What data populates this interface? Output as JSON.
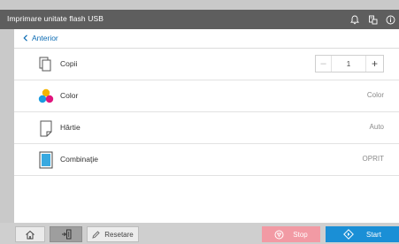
{
  "header": {
    "title": "Imprimare unitate flash USB",
    "icons": [
      "bell-icon",
      "usb-connection-icon",
      "info-icon"
    ]
  },
  "nav": {
    "back_label": "Anterior"
  },
  "settings": [
    {
      "id": "copies",
      "label": "Copii",
      "icon": "copies-icon",
      "value": "1"
    },
    {
      "id": "color",
      "label": "Color",
      "icon": "color-dots-icon",
      "value": "Color"
    },
    {
      "id": "paper",
      "label": "Hârtie",
      "icon": "paper-icon",
      "value": "Auto"
    },
    {
      "id": "combination",
      "label": "Combinaţie",
      "icon": "combination-icon",
      "value": "OPRIT"
    }
  ],
  "stepper": {
    "minus": "–",
    "plus": "+"
  },
  "bottom": {
    "reset_label": "Resetare",
    "stop_label": "Stop",
    "start_label": "Start"
  },
  "colors": {
    "titlebar": "#5e5e5e",
    "link": "#0b6bb3",
    "stop": "#f29aa4",
    "start": "#1a8fd6",
    "color_dots": [
      "#f5b400",
      "#1b9be0",
      "#e0157d"
    ]
  }
}
